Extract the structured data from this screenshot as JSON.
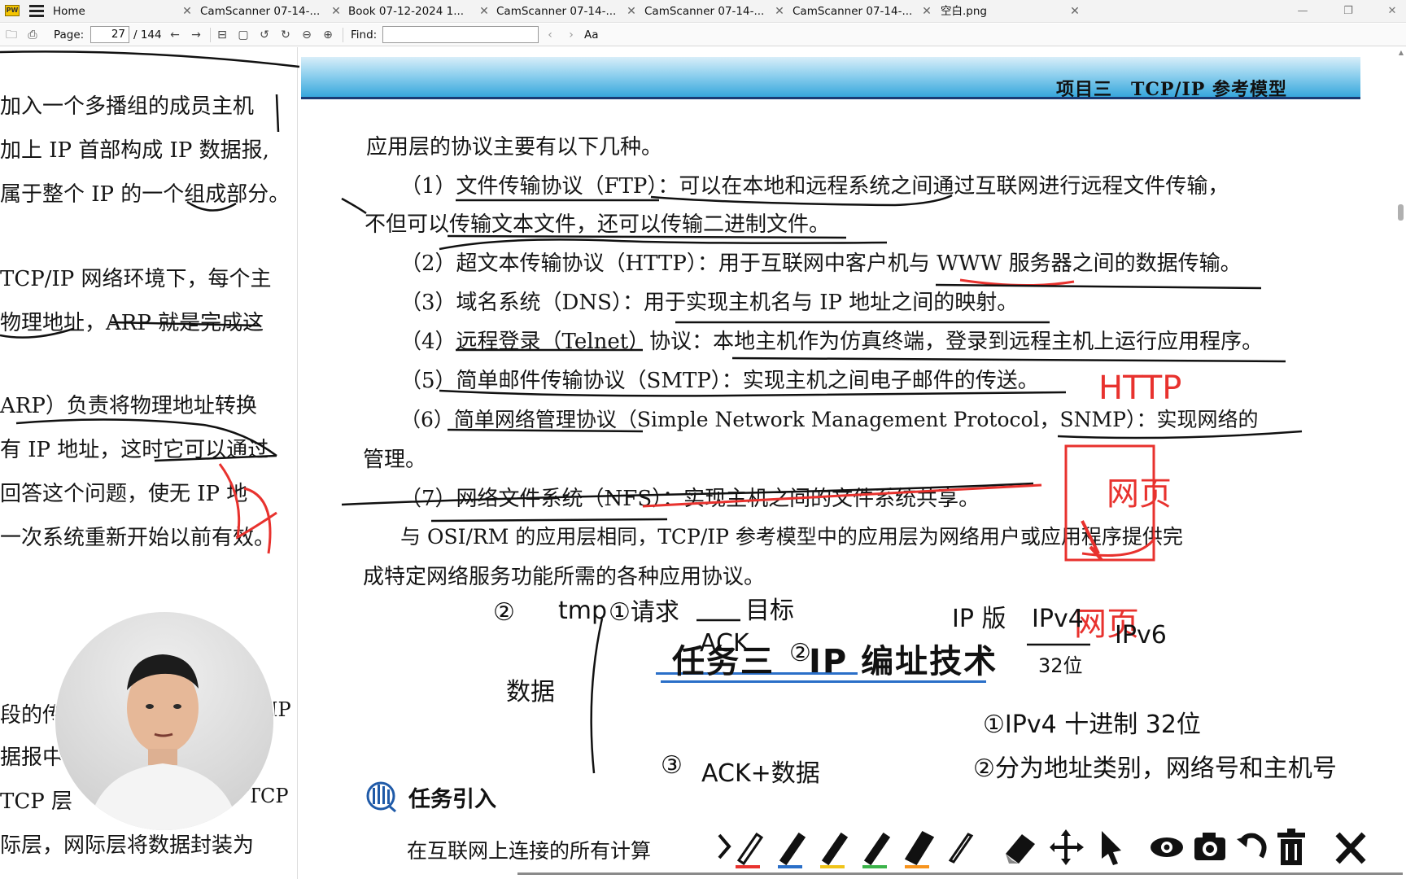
{
  "tabs": [
    {
      "label": "Home"
    },
    {
      "label": "CamScanner 07-14-..."
    },
    {
      "label": "Book 07-12-2024 1..."
    },
    {
      "label": "CamScanner 07-14-..."
    },
    {
      "label": "CamScanner 07-14-..."
    },
    {
      "label": "CamScanner 07-14-..."
    },
    {
      "label": "空白.png"
    }
  ],
  "toolbar": {
    "page_label": "Page:",
    "page_value": "27",
    "page_total": "/ 144",
    "find_label": "Find:",
    "find_value": "",
    "case_label": "Aa"
  },
  "left_page": {
    "lines": [
      "加入一个多播组的成员主机",
      "加上 IP 首部构成 IP 数据报,",
      "属于整个 IP 的一个组成部分。",
      "TCP/IP 网络环境下，每个主",
      "物理地址，ARP 就是完成这",
      "ARP）负责将物理地址转换",
      "有 IP 地址，这时它可以通过",
      "回答这个问题，使无 IP 地",
      "一次系统重新开始以前有效。",
      "段的传",
      "据报中",
      "TCP 层",
      "际层，网际层将数据封装为"
    ],
    "right_fragments": [
      "IP",
      "TCP"
    ]
  },
  "header": {
    "title": "项目三　TCP/IP 参考模型"
  },
  "body": {
    "lines": [
      "应用层的协议主要有以下几种。",
      "（1）文件传输协议（FTP）：可以在本地和远程系统之间通过互联网进行远程文件传输，",
      "不但可以传输文本文件，还可以传输二进制文件。",
      "（2）超文本传输协议（HTTP）：用于互联网中客户机与 WWW 服务器之间的数据传输。",
      "（3）域名系统（DNS）：用于实现主机名与 IP 地址之间的映射。",
      "（4）远程登录（Telnet）协议：本地主机作为仿真终端，登录到远程主机上运行应用程序。",
      "（5）简单邮件传输协议（SMTP）：实现主机之间电子邮件的传送。",
      "（6）简单网络管理协议（Simple Network Management Protocol，SNMP）：实现网络的",
      "管理。",
      "（7）网络文件系统（NFS）：实现主机之间的文件系统共享。",
      "与 OSI/RM 的应用层相同，TCP/IP 参考模型中的应用层为网络用户或应用程序提供完",
      "成特定网络服务功能所需的各种应用协议。"
    ],
    "task_heading": "任务三　IP 编址技术",
    "task_intro": "任务引入",
    "bottom_line": "在互联网上连接的所有计算"
  },
  "annotations": {
    "red": [
      "HTTP",
      "网页",
      "网页"
    ],
    "black": [
      "tmp",
      "①请求",
      "目标",
      "ACK",
      "②",
      "③",
      "数据",
      "ACK+数据",
      "IP 版",
      "IPv4",
      "IPv6",
      "32位",
      "①IPv4 十进制 32位",
      "②分为地址类别，网络号和主机号",
      "②"
    ]
  },
  "pen_tools": [
    "red-pen-icon",
    "blue-pen-icon",
    "yellow-pen-icon",
    "green-pen-icon",
    "orange-highlighter-icon",
    "black-pen-icon",
    "eraser-icon",
    "move-icon",
    "pointer-icon",
    "eye-icon",
    "camera-icon",
    "undo-icon",
    "trash-icon",
    "close-icon"
  ],
  "colors": {
    "accent_red": "#e8322e",
    "header_blue": "#37a7dc",
    "header_dark": "#1a3b75",
    "task_blue": "#2a6fc8"
  }
}
